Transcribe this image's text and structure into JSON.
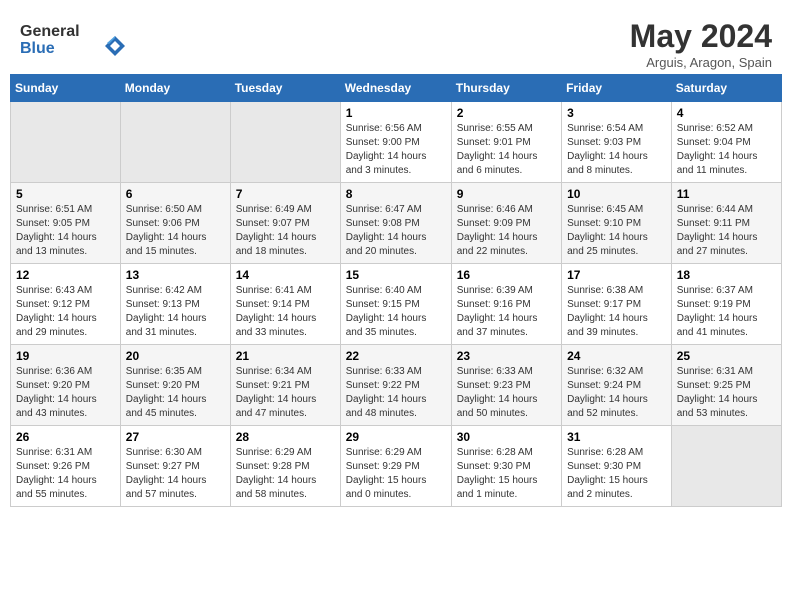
{
  "header": {
    "logo_line1": "General",
    "logo_line2": "Blue",
    "month": "May 2024",
    "location": "Arguis, Aragon, Spain"
  },
  "weekdays": [
    "Sunday",
    "Monday",
    "Tuesday",
    "Wednesday",
    "Thursday",
    "Friday",
    "Saturday"
  ],
  "weeks": [
    [
      {
        "day": "",
        "info": ""
      },
      {
        "day": "",
        "info": ""
      },
      {
        "day": "",
        "info": ""
      },
      {
        "day": "1",
        "info": "Sunrise: 6:56 AM\nSunset: 9:00 PM\nDaylight: 14 hours\nand 3 minutes."
      },
      {
        "day": "2",
        "info": "Sunrise: 6:55 AM\nSunset: 9:01 PM\nDaylight: 14 hours\nand 6 minutes."
      },
      {
        "day": "3",
        "info": "Sunrise: 6:54 AM\nSunset: 9:03 PM\nDaylight: 14 hours\nand 8 minutes."
      },
      {
        "day": "4",
        "info": "Sunrise: 6:52 AM\nSunset: 9:04 PM\nDaylight: 14 hours\nand 11 minutes."
      }
    ],
    [
      {
        "day": "5",
        "info": "Sunrise: 6:51 AM\nSunset: 9:05 PM\nDaylight: 14 hours\nand 13 minutes."
      },
      {
        "day": "6",
        "info": "Sunrise: 6:50 AM\nSunset: 9:06 PM\nDaylight: 14 hours\nand 15 minutes."
      },
      {
        "day": "7",
        "info": "Sunrise: 6:49 AM\nSunset: 9:07 PM\nDaylight: 14 hours\nand 18 minutes."
      },
      {
        "day": "8",
        "info": "Sunrise: 6:47 AM\nSunset: 9:08 PM\nDaylight: 14 hours\nand 20 minutes."
      },
      {
        "day": "9",
        "info": "Sunrise: 6:46 AM\nSunset: 9:09 PM\nDaylight: 14 hours\nand 22 minutes."
      },
      {
        "day": "10",
        "info": "Sunrise: 6:45 AM\nSunset: 9:10 PM\nDaylight: 14 hours\nand 25 minutes."
      },
      {
        "day": "11",
        "info": "Sunrise: 6:44 AM\nSunset: 9:11 PM\nDaylight: 14 hours\nand 27 minutes."
      }
    ],
    [
      {
        "day": "12",
        "info": "Sunrise: 6:43 AM\nSunset: 9:12 PM\nDaylight: 14 hours\nand 29 minutes."
      },
      {
        "day": "13",
        "info": "Sunrise: 6:42 AM\nSunset: 9:13 PM\nDaylight: 14 hours\nand 31 minutes."
      },
      {
        "day": "14",
        "info": "Sunrise: 6:41 AM\nSunset: 9:14 PM\nDaylight: 14 hours\nand 33 minutes."
      },
      {
        "day": "15",
        "info": "Sunrise: 6:40 AM\nSunset: 9:15 PM\nDaylight: 14 hours\nand 35 minutes."
      },
      {
        "day": "16",
        "info": "Sunrise: 6:39 AM\nSunset: 9:16 PM\nDaylight: 14 hours\nand 37 minutes."
      },
      {
        "day": "17",
        "info": "Sunrise: 6:38 AM\nSunset: 9:17 PM\nDaylight: 14 hours\nand 39 minutes."
      },
      {
        "day": "18",
        "info": "Sunrise: 6:37 AM\nSunset: 9:19 PM\nDaylight: 14 hours\nand 41 minutes."
      }
    ],
    [
      {
        "day": "19",
        "info": "Sunrise: 6:36 AM\nSunset: 9:20 PM\nDaylight: 14 hours\nand 43 minutes."
      },
      {
        "day": "20",
        "info": "Sunrise: 6:35 AM\nSunset: 9:20 PM\nDaylight: 14 hours\nand 45 minutes."
      },
      {
        "day": "21",
        "info": "Sunrise: 6:34 AM\nSunset: 9:21 PM\nDaylight: 14 hours\nand 47 minutes."
      },
      {
        "day": "22",
        "info": "Sunrise: 6:33 AM\nSunset: 9:22 PM\nDaylight: 14 hours\nand 48 minutes."
      },
      {
        "day": "23",
        "info": "Sunrise: 6:33 AM\nSunset: 9:23 PM\nDaylight: 14 hours\nand 50 minutes."
      },
      {
        "day": "24",
        "info": "Sunrise: 6:32 AM\nSunset: 9:24 PM\nDaylight: 14 hours\nand 52 minutes."
      },
      {
        "day": "25",
        "info": "Sunrise: 6:31 AM\nSunset: 9:25 PM\nDaylight: 14 hours\nand 53 minutes."
      }
    ],
    [
      {
        "day": "26",
        "info": "Sunrise: 6:31 AM\nSunset: 9:26 PM\nDaylight: 14 hours\nand 55 minutes."
      },
      {
        "day": "27",
        "info": "Sunrise: 6:30 AM\nSunset: 9:27 PM\nDaylight: 14 hours\nand 57 minutes."
      },
      {
        "day": "28",
        "info": "Sunrise: 6:29 AM\nSunset: 9:28 PM\nDaylight: 14 hours\nand 58 minutes."
      },
      {
        "day": "29",
        "info": "Sunrise: 6:29 AM\nSunset: 9:29 PM\nDaylight: 15 hours\nand 0 minutes."
      },
      {
        "day": "30",
        "info": "Sunrise: 6:28 AM\nSunset: 9:30 PM\nDaylight: 15 hours\nand 1 minute."
      },
      {
        "day": "31",
        "info": "Sunrise: 6:28 AM\nSunset: 9:30 PM\nDaylight: 15 hours\nand 2 minutes."
      },
      {
        "day": "",
        "info": ""
      }
    ]
  ]
}
